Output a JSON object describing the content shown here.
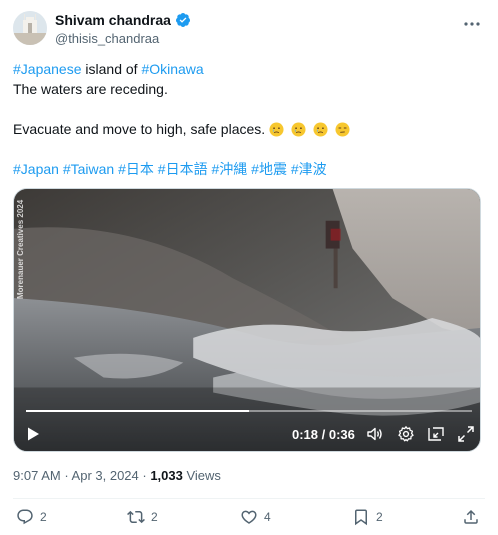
{
  "author": {
    "name": "Shivam chandraa",
    "handle": "@thisis_chandraa",
    "verified": true
  },
  "tweet": {
    "hashtag_japanese": "#Japanese",
    "text_island_of": " island of ",
    "hashtag_okinawa": "#Okinawa",
    "line2": "The waters are receding.",
    "line3": "Evacuate and move to high, safe places.",
    "emojis": [
      "crying-face",
      "crying-face",
      "crying-face",
      "unamused-face"
    ],
    "hashtags": [
      "#Japan",
      "#Taiwan",
      "#日本",
      "#日本語",
      "#沖縄",
      "#地震",
      "#津波"
    ]
  },
  "video": {
    "watermark": "Morenauer Creatives 2024",
    "current_time": "0:18",
    "duration": "0:36",
    "time_display": "0:18 / 0:36",
    "progress": 0.5
  },
  "meta": {
    "time": "9:07 AM",
    "separator1": " · ",
    "date": "Apr 3, 2024",
    "separator2": " · ",
    "views_count": "1,033",
    "views_label": " Views"
  },
  "actions": {
    "replies": "2",
    "reposts": "2",
    "likes": "4",
    "bookmarks": "2"
  },
  "colors": {
    "accent": "#1d9bf0",
    "text": "#0f1419",
    "secondary": "#536471"
  }
}
